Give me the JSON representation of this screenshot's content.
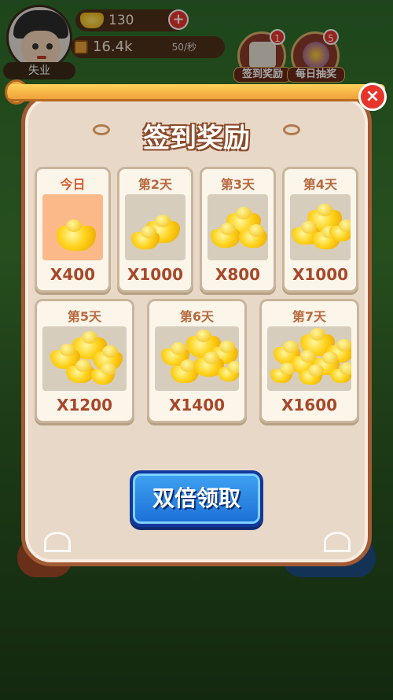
{
  "hud": {
    "player_name": "失业",
    "gold_amount": "130",
    "coin_amount": "16.4k",
    "coin_rate": "50/秒",
    "add_symbol": "+"
  },
  "top_buttons": [
    {
      "label": "签到奖励",
      "badge": "1"
    },
    {
      "label": "每日抽奖",
      "badge": "5"
    }
  ],
  "modal": {
    "title": "签到奖励",
    "close_symbol": "×",
    "claim_button": "双倍领取",
    "rewards": [
      {
        "day": "今日",
        "amount": "X400",
        "today": true
      },
      {
        "day": "第2天",
        "amount": "X1000"
      },
      {
        "day": "第3天",
        "amount": "X800"
      },
      {
        "day": "第4天",
        "amount": "X1000"
      },
      {
        "day": "第5天",
        "amount": "X1200"
      },
      {
        "day": "第6天",
        "amount": "X1400"
      },
      {
        "day": "第7天",
        "amount": "X1600"
      }
    ]
  },
  "colors": {
    "modal_border": "#a25a34",
    "title_outline": "#8b4a2a",
    "amount_text": "#a8482a",
    "claim_button": "#1c6fd6",
    "close_button": "#e8352b"
  }
}
